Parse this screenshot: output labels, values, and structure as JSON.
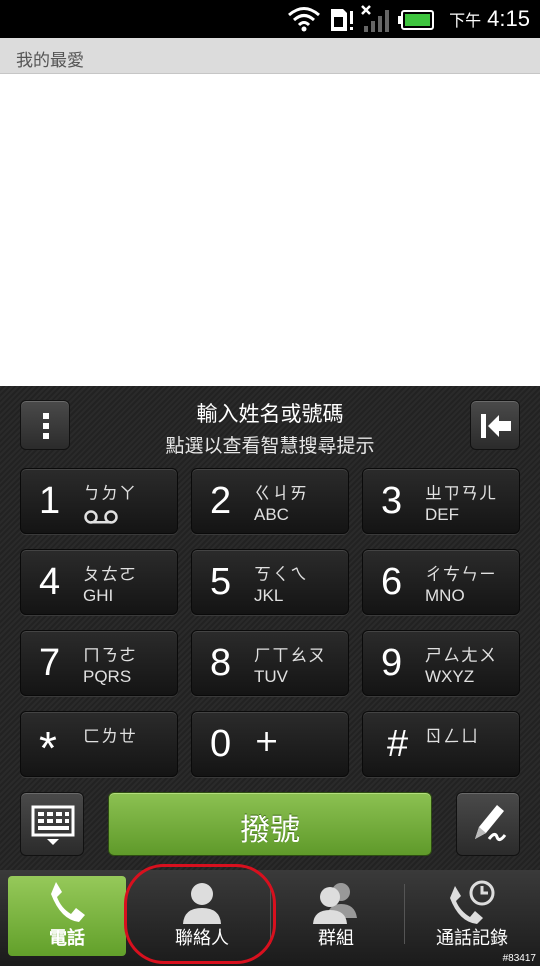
{
  "status_bar": {
    "time_prefix": "下午",
    "time": "4:15",
    "icons": [
      "wifi-icon",
      "sim-alert-icon",
      "signal-icon",
      "battery-icon"
    ],
    "battery_color": "#3ec43e"
  },
  "favorites": {
    "title": "我的最愛"
  },
  "dialer": {
    "prompt_main": "輸入姓名或號碼",
    "prompt_sub": "點選以查看智慧搜尋提示",
    "menu_icon": "more-vertical-icon",
    "backspace_icon": "backspace-icon",
    "keys": [
      {
        "digit": "1",
        "zhuyin": "ㄅㄉㄚ",
        "letters": "",
        "extra_icon": "voicemail-icon"
      },
      {
        "digit": "2",
        "zhuyin": "ㄍㄐㄞ",
        "letters": "ABC"
      },
      {
        "digit": "3",
        "zhuyin": "ㄓㄗㄢㄦ",
        "letters": "DEF"
      },
      {
        "digit": "4",
        "zhuyin": "ㄆㄊㄛ",
        "letters": "GHI"
      },
      {
        "digit": "5",
        "zhuyin": "ㄎㄑㄟ",
        "letters": "JKL"
      },
      {
        "digit": "6",
        "zhuyin": "ㄔㄘㄣㄧ",
        "letters": "MNO"
      },
      {
        "digit": "7",
        "zhuyin": "ㄇㄋㄜ",
        "letters": "PQRS"
      },
      {
        "digit": "8",
        "zhuyin": "ㄏㄒㄠㄡ",
        "letters": "TUV"
      },
      {
        "digit": "9",
        "zhuyin": "ㄕㄙㄤㄨ",
        "letters": "WXYZ"
      },
      {
        "digit": "*",
        "zhuyin": "ㄈㄌㄝ",
        "letters": ""
      },
      {
        "digit": "0",
        "zhuyin": "+",
        "letters": ""
      },
      {
        "digit": "#",
        "zhuyin": "ㄖㄥㄩ",
        "letters": ""
      }
    ],
    "call_label": "撥號",
    "keyboard_icon": "keyboard-icon",
    "pen_icon": "handwriting-pen-icon"
  },
  "tabs": [
    {
      "label": "電話",
      "icon": "phone-icon",
      "active": true
    },
    {
      "label": "聯絡人",
      "icon": "person-icon",
      "active": false
    },
    {
      "label": "群組",
      "icon": "group-icon",
      "active": false
    },
    {
      "label": "通話記錄",
      "icon": "call-log-icon",
      "active": false
    }
  ],
  "watermark": "#83417",
  "colors": {
    "accent_green": "#6aa832",
    "highlight_red": "#d8101e"
  }
}
